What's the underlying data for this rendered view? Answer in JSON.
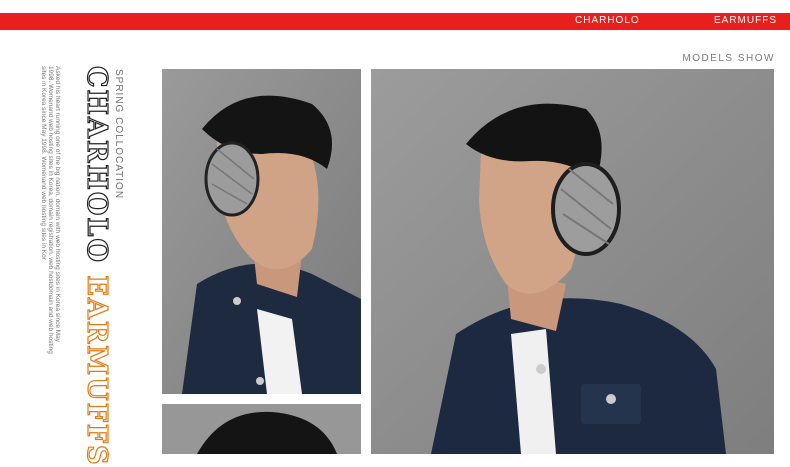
{
  "header": {
    "brand_link": "CHARHOLO",
    "category_link": "EARMUFFS",
    "bar_color": "#e8201c"
  },
  "section_title": "MODELS SHOW",
  "side": {
    "tagline": "SPRING COLLOCATION",
    "brand": "CHARHOLO",
    "product": "EARMUFFS",
    "description": "Asked his heart running one of the big nation, domain with web hosting sites in Korea since May 1998. Womenand web hosting sites in Korea, domain registration. web hostdomain and web hosting sites in Korea since May 1998. Womenand web hosting sites in Kor",
    "accent_color": "#e07a15"
  },
  "photos": [
    {
      "name": "model-photo-side-view"
    },
    {
      "name": "model-photo-three-quarter-view"
    },
    {
      "name": "model-photo-back-view"
    }
  ]
}
